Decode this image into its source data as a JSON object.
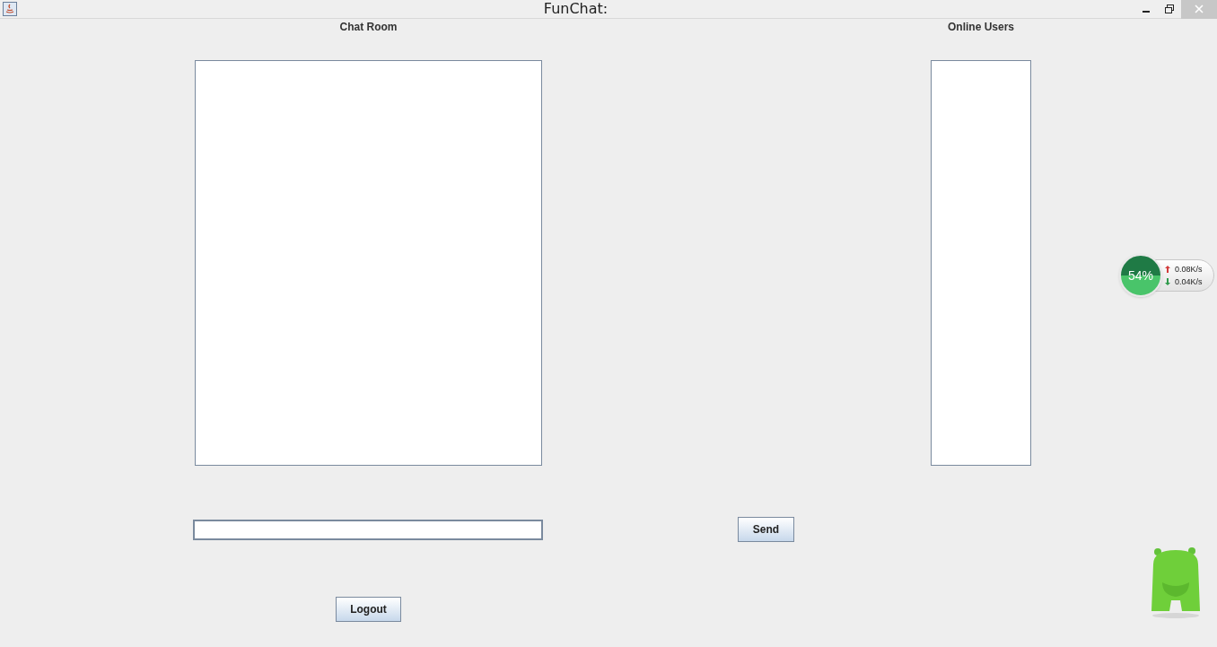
{
  "window": {
    "title": "FunChat:"
  },
  "labels": {
    "chat": "Chat Room",
    "users": "Online Users"
  },
  "buttons": {
    "send": "Send",
    "logout": "Logout"
  },
  "network_widget": {
    "percent": "54%",
    "upload": "0.08K/s",
    "download": "0.04K/s"
  }
}
